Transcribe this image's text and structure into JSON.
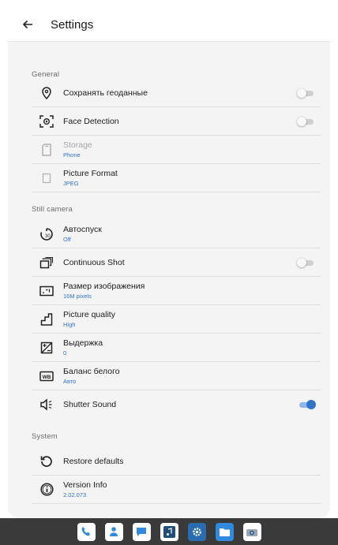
{
  "appbar": {
    "title": "Settings",
    "back_icon": "back-arrow-icon"
  },
  "sections": {
    "general": "General",
    "still_camera": "Still camera",
    "system": "System"
  },
  "general": {
    "geodata": {
      "label": "Сохранять геоданные",
      "on": false
    },
    "face_detection": {
      "label": "Face Detection",
      "on": false
    },
    "storage": {
      "label": "Storage",
      "value": "Phone"
    },
    "picture_format": {
      "label": "Picture Format",
      "value": "JPEG"
    }
  },
  "still_camera": {
    "self_timer": {
      "label": "Автоспуск",
      "value": "Off"
    },
    "continuous_shot": {
      "label": "Continuous Shot",
      "on": false
    },
    "image_size": {
      "label": "Размер изображения",
      "value": "16M pixels"
    },
    "picture_quality": {
      "label": "Picture quality",
      "value": "High"
    },
    "exposure": {
      "label": "Выдержка",
      "value": "0"
    },
    "white_balance": {
      "label": "Баланс белого",
      "value": "Авто"
    },
    "shutter_sound": {
      "label": "Shutter Sound",
      "on": true
    }
  },
  "system": {
    "restore_defaults": {
      "label": "Restore defaults"
    },
    "version_info": {
      "label": "Version Info",
      "value": "2.02.073"
    }
  },
  "dock": {
    "apps": [
      "phone-app-icon",
      "contacts-app-icon",
      "messages-app-icon",
      "music-app-icon",
      "settings-app-icon",
      "files-app-icon",
      "camera-app-icon"
    ]
  },
  "colors": {
    "accent": "#2f74c9",
    "background": "#f4f4f4",
    "dock": "#3a3a3a"
  }
}
